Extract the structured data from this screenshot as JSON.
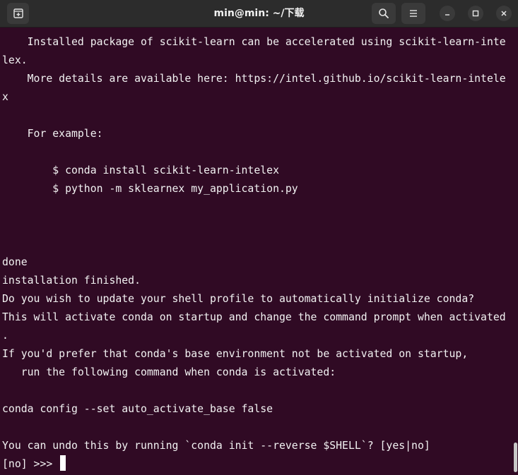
{
  "window": {
    "title": "min@min: ~/下载"
  },
  "titlebar": {
    "new_tab_icon": "new-tab-icon",
    "search_icon": "search-icon",
    "menu_icon": "hamburger-menu-icon",
    "minimize_icon": "minimize-icon",
    "maximize_icon": "maximize-icon",
    "close_icon": "close-icon"
  },
  "terminal": {
    "lines": [
      "    Installed package of scikit-learn can be accelerated using scikit-learn-inte",
      "lex.",
      "    More details are available here: https://intel.github.io/scikit-learn-intele",
      "x",
      "",
      "    For example:",
      "",
      "        $ conda install scikit-learn-intelex",
      "        $ python -m sklearnex my_application.py",
      "",
      "",
      "",
      "done",
      "installation finished.",
      "Do you wish to update your shell profile to automatically initialize conda?",
      "This will activate conda on startup and change the command prompt when activated",
      ".",
      "If you'd prefer that conda's base environment not be activated on startup,",
      "   run the following command when conda is activated:",
      "",
      "conda config --set auto_activate_base false",
      "",
      "You can undo this by running `conda init --reverse $SHELL`? [yes|no]"
    ],
    "prompt": "[no] >>> "
  },
  "colors": {
    "background": "#300a24",
    "titlebar": "#2c2c2c",
    "text": "#f2f2f2"
  }
}
